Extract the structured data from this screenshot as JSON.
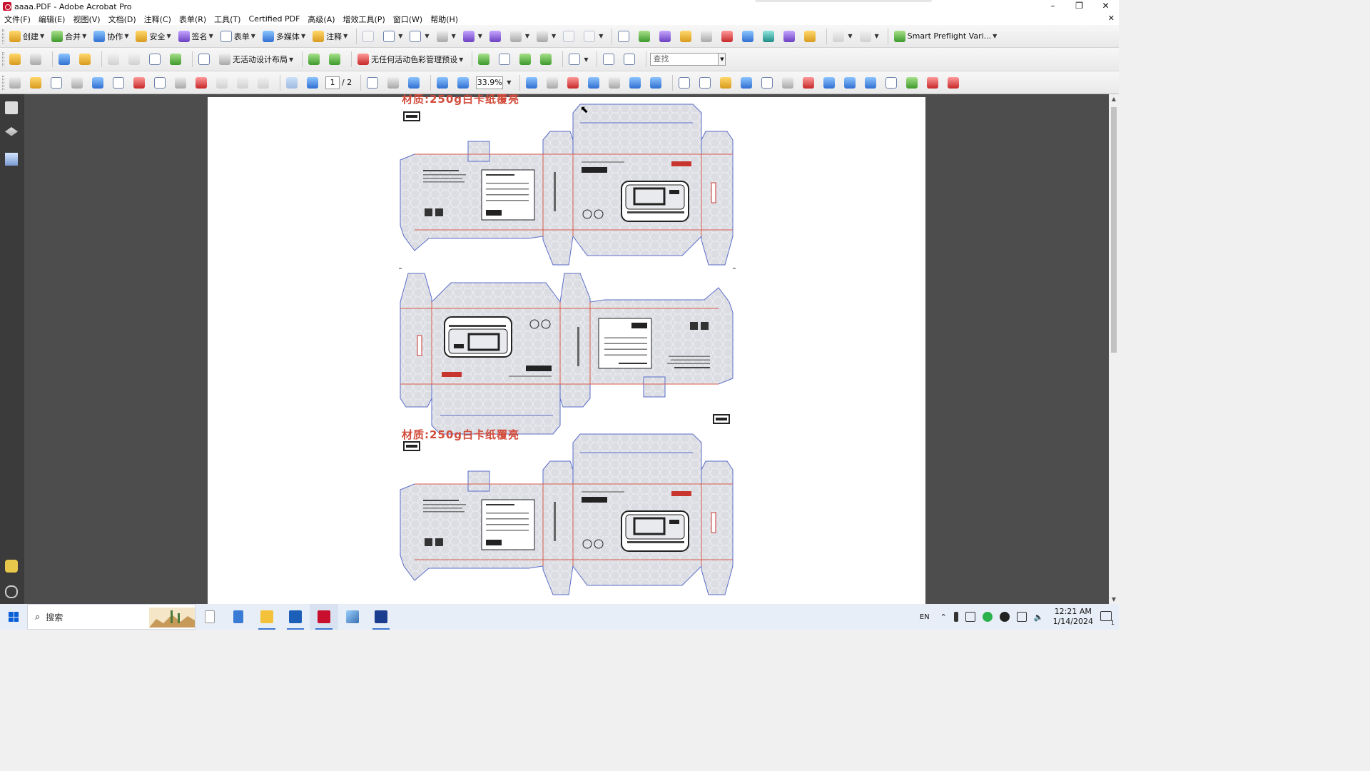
{
  "window": {
    "title": "aaaa.PDF - Adobe Acrobat Pro",
    "controls": {
      "minimize": "–",
      "maximize": "❐",
      "close": "✕"
    }
  },
  "menubar": {
    "items": [
      "文件(F)",
      "编辑(E)",
      "视图(V)",
      "文档(D)",
      "注释(C)",
      "表单(R)",
      "工具(T)",
      "Certified PDF",
      "高级(A)",
      "增效工具(P)",
      "窗口(W)",
      "帮助(H)"
    ],
    "close_doc": "✕"
  },
  "toolbar1": {
    "create": "创建",
    "combine": "合并",
    "collaborate": "协作",
    "secure": "安全",
    "sign": "签名",
    "forms": "表单",
    "multimedia": "多媒体",
    "comment": "注释",
    "preflight": "Smart Preflight Vari..."
  },
  "toolbar2": {
    "layout": "无活动设计布局",
    "color_preset": "无任何活动色彩管理预设",
    "find_placeholder": "查找"
  },
  "toolbar3": {
    "page_current": "1",
    "page_total": "/ 2",
    "zoom": "33.9%"
  },
  "document": {
    "red_header_text": "材质:250g白卡纸覆亮"
  },
  "taskbar": {
    "search_placeholder": "搜索",
    "language": "EN",
    "time": "12:21 AM",
    "date": "1/14/2024",
    "notification_count": "1"
  },
  "colors": {
    "page_bg": "#4d4d4d",
    "nav_pane": "#3b3b3b",
    "dieline_cut": "#d85a4a",
    "box_fill": "#dcdde3"
  }
}
